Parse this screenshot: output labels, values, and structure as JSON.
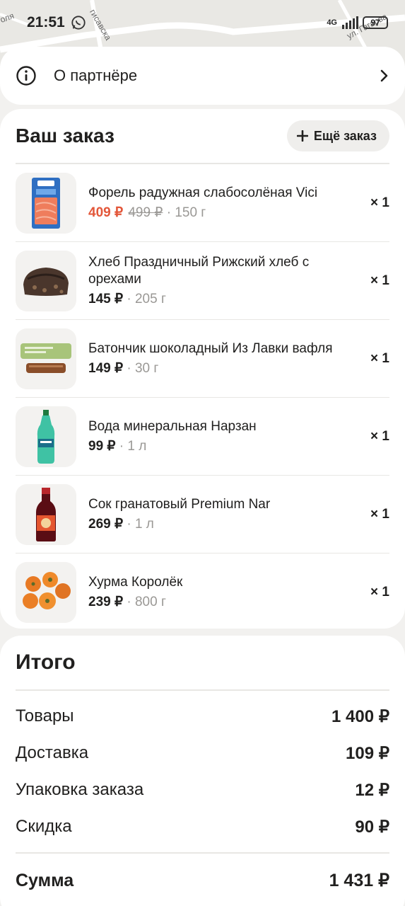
{
  "status_bar": {
    "time": "21:51",
    "network": "4G",
    "battery": "97",
    "map_labels": [
      "оля",
      "гисавска",
      "ул. Гагарва"
    ]
  },
  "partner": {
    "label": "О партнёре",
    "info_icon": "info-icon",
    "chevron_icon": "chevron-right-icon"
  },
  "order": {
    "title": "Ваш заказ",
    "more_button": "Ещё заказ",
    "items": [
      {
        "name": "Форель радужная слабосолёная Vici",
        "price": "409 ₽",
        "old_price": "499 ₽",
        "weight": "· 150 г",
        "qty": "× 1",
        "thumb": "fish-pack-icon"
      },
      {
        "name": "Хлеб Праздничный Рижский хлеб с орехами",
        "price": "145 ₽",
        "old_price": "",
        "weight": "· 205 г",
        "qty": "× 1",
        "thumb": "bread-icon"
      },
      {
        "name": "Батончик шоколадный Из Лавки вафля",
        "price": "149 ₽",
        "old_price": "",
        "weight": "· 30 г",
        "qty": "× 1",
        "thumb": "chocolate-bar-icon"
      },
      {
        "name": "Вода минеральная Нарзан",
        "price": "99 ₽",
        "old_price": "",
        "weight": "· 1 л",
        "qty": "× 1",
        "thumb": "water-bottle-icon"
      },
      {
        "name": "Сок гранатовый Premium Nar",
        "price": "269 ₽",
        "old_price": "",
        "weight": "· 1 л",
        "qty": "× 1",
        "thumb": "juice-bottle-icon"
      },
      {
        "name": "Хурма Королёк",
        "price": "239 ₽",
        "old_price": "",
        "weight": "· 800 г",
        "qty": "× 1",
        "thumb": "persimmon-icon"
      }
    ]
  },
  "totals": {
    "title": "Итого",
    "rows": [
      {
        "label": "Товары",
        "value": "1 400 ₽"
      },
      {
        "label": "Доставка",
        "value": "109 ₽"
      },
      {
        "label": "Упаковка заказа",
        "value": "12 ₽"
      },
      {
        "label": "Скидка",
        "value": "90 ₽"
      }
    ],
    "sum_label": "Сумма",
    "sum_value": "1 431 ₽"
  },
  "colors": {
    "sale_price": "#e3573a",
    "muted": "#9a9895",
    "card_bg": "#ffffff",
    "page_bg": "#f2f1ef"
  }
}
